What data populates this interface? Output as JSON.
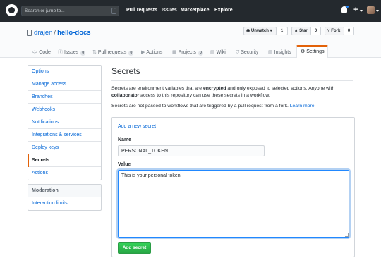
{
  "header": {
    "search_placeholder": "Search or jump to...",
    "search_shortcut": "/",
    "nav": [
      "Pull requests",
      "Issues",
      "Marketplace",
      "Explore"
    ],
    "plus_label": "+"
  },
  "repo": {
    "owner": "drajen",
    "separator": "/",
    "name": "hello-docs",
    "watch_label": "Unwatch",
    "watch_count": "1",
    "star_label": "Star",
    "star_count": "0",
    "fork_label": "Fork",
    "fork_count": "0"
  },
  "tabs": [
    {
      "icon": "<>",
      "label": "Code",
      "count": ""
    },
    {
      "icon": "ⓘ",
      "label": "Issues",
      "count": "0"
    },
    {
      "icon": "⇅",
      "label": "Pull requests",
      "count": "0"
    },
    {
      "icon": "▶",
      "label": "Actions",
      "count": ""
    },
    {
      "icon": "▦",
      "label": "Projects",
      "count": "0"
    },
    {
      "icon": "▤",
      "label": "Wiki",
      "count": ""
    },
    {
      "icon": "⛉",
      "label": "Security",
      "count": ""
    },
    {
      "icon": "▥",
      "label": "Insights",
      "count": ""
    },
    {
      "icon": "⚙",
      "label": "Settings",
      "count": ""
    }
  ],
  "sidebar": {
    "items": [
      "Options",
      "Manage access",
      "Branches",
      "Webhooks",
      "Notifications",
      "Integrations & services",
      "Deploy keys",
      "Secrets",
      "Actions"
    ],
    "active": "Secrets",
    "moderation_heading": "Moderation",
    "moderation_items": [
      "Interaction limits"
    ]
  },
  "main": {
    "title": "Secrets",
    "p1_a": "Secrets are environment variables that are ",
    "p1_b": "encrypted",
    "p1_c": " and only exposed to selected actions. Anyone with ",
    "p1_d": "collaborator",
    "p1_e": " access to this repository can use these secrets in a workflow.",
    "p2_a": "Secrets are not passed to workflows that are triggered by a pull request from a fork. ",
    "p2_link": "Learn more.",
    "add_new_link": "Add a new secret",
    "name_label": "Name",
    "name_value": "PERSONAL_TOKEN",
    "value_label": "Value",
    "value_text": "This is your personal token",
    "submit_label": "Add secret"
  },
  "colors": {
    "header_bg": "#24292e",
    "link": "#0366d6",
    "active_tab_accent": "#e36209",
    "primary_button": "#28a745"
  }
}
